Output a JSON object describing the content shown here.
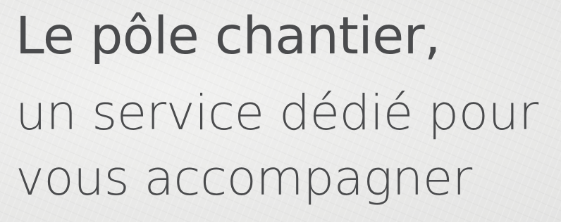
{
  "heading": {
    "line1": "Le pôle chantier,",
    "line2": "un service dédié pour",
    "line3": "vous accompagner"
  },
  "colors": {
    "text": "#4a4b4d",
    "background": "#ebebea"
  }
}
